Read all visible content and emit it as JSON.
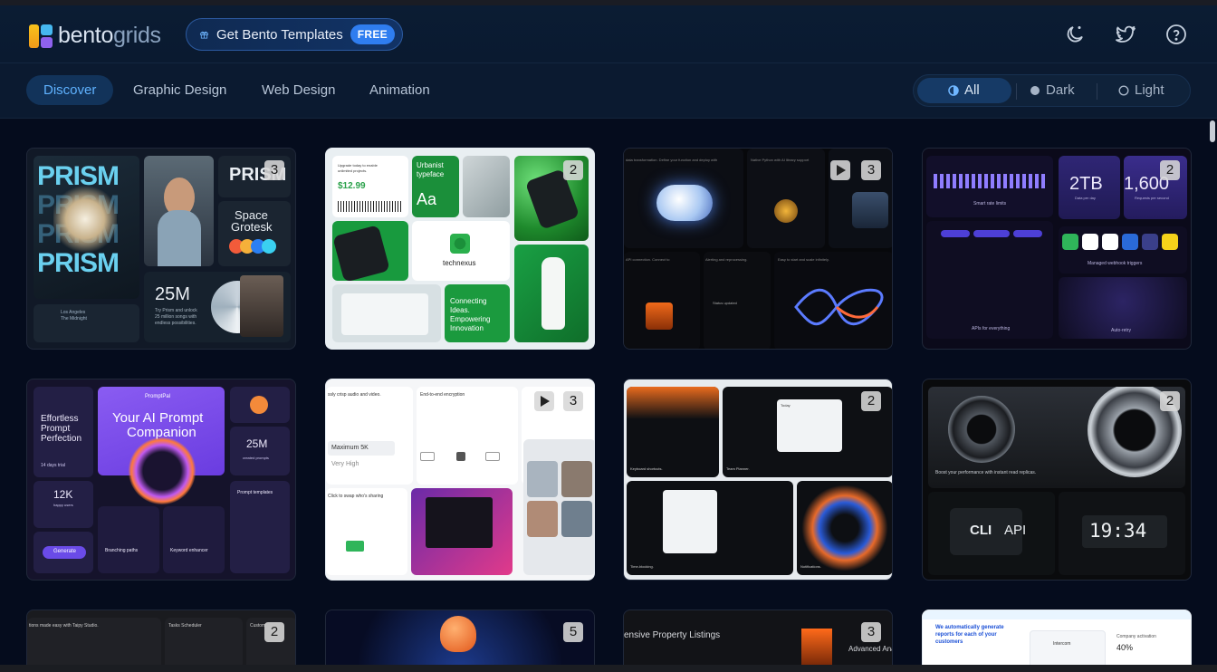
{
  "header": {
    "logo_word_a": "bento",
    "logo_word_b": "grids",
    "templates_label": "Get Bento Templates",
    "templates_badge": "FREE",
    "icons": [
      "theme-moon-icon",
      "twitter-icon",
      "help-icon"
    ]
  },
  "nav": {
    "tabs": [
      {
        "label": "Discover",
        "active": true
      },
      {
        "label": "Graphic Design",
        "active": false
      },
      {
        "label": "Web Design",
        "active": false
      },
      {
        "label": "Animation",
        "active": false
      }
    ],
    "theme": {
      "options": [
        {
          "label": "All",
          "active": true
        },
        {
          "label": "Dark",
          "active": false
        },
        {
          "label": "Light",
          "active": false
        }
      ]
    }
  },
  "cards": [
    {
      "count": "3",
      "video": false,
      "text": {
        "title": "PRISM",
        "space": "Space",
        "grotesk": "Grotesk",
        "big": "25M",
        "promo": "Try Prism and unlock",
        "promo2": "25 million songs with",
        "promo3": "endless possibilities.",
        "city": "Los Angeles",
        "sub": "The Midnight"
      }
    },
    {
      "count": "2",
      "video": false,
      "text": {
        "price": "$12.99",
        "upgrade": "Upgrade today to enable",
        "upgrade2": "unlimited projects.",
        "urbanist": "Urbanist",
        "typeface": "typeface",
        "aa": "Aa",
        "brand": "technexus",
        "connect": "Connecting",
        "connect2": "Ideas.",
        "connect3": "Empowering",
        "connect4": "Innovation",
        "bottle": "technexus"
      }
    },
    {
      "count": "3",
      "video": true,
      "text": {
        "a": "data transformation. Define your function and deploy with",
        "b": "Native Python with AI library support",
        "c": "API connection. Connect to",
        "d": "Alerting and reprocessing.",
        "e": "Easy to start and scale infinitely.",
        "f": "Status updated"
      }
    },
    {
      "count": "2",
      "video": false,
      "text": {
        "big1": "2TB",
        "big1_sub": "Data per day",
        "big2": "1,600",
        "big2_sub": "Requests per second",
        "rate": "Smart rate limits",
        "webhook": "Managed webhook triggers",
        "apis": "APIs for everything",
        "retry": "Auto-retry"
      }
    },
    {
      "count": "",
      "video": false,
      "text": {
        "a": "Effortless",
        "b": "Prompt",
        "c": "Perfection",
        "d": "14 days trial",
        "title1": "Your AI Prompt",
        "title2": "Companion",
        "pp": "PromptPal",
        "k": "12K",
        "k_sub": "happy users",
        "m": "25M",
        "m_sub": "created prompts",
        "gen": "Generate",
        "branch": "Branching paths",
        "keyword": "Keyword enhancer",
        "templates": "Prompt templates"
      }
    },
    {
      "count": "3",
      "video": true,
      "text": {
        "a": "ssly crisp audio and video.",
        "b": "End-to-end encryption",
        "c": "Maximum 5K",
        "d": "Very High",
        "e": "Click to swap who's sharing"
      }
    },
    {
      "count": "2",
      "video": false,
      "text": {
        "a": "Keyboard shortcuts.",
        "b": "Team Planner.",
        "c": "Time-blocking.",
        "d": "Notifications.",
        "e": "Today"
      }
    },
    {
      "count": "2",
      "video": false,
      "text": {
        "a": "Boost your performance with instant read replicas.",
        "cli": "CLI",
        "api": "API",
        "clock": "19:34"
      }
    },
    {
      "count": "2",
      "video": false,
      "text": {
        "a": "tions made easy with Taipy Studio.",
        "b": "Tasks Scheduler",
        "c": "Custom"
      }
    },
    {
      "count": "5",
      "video": false,
      "text": {}
    },
    {
      "count": "3",
      "video": false,
      "text": {
        "a": "ensive Property Listings",
        "b": "Advanced Ana"
      }
    },
    {
      "count": "",
      "video": false,
      "text": {
        "a": "We automatically generate",
        "b": "reports for each of your",
        "c": "customers",
        "d": "Intercom",
        "e": "Company activation",
        "f": "40%"
      }
    }
  ],
  "colors": {
    "bg": "#050c1d",
    "header": "#0b1c33",
    "accent": "#5fb2ff",
    "badge": "#2f7df0"
  }
}
